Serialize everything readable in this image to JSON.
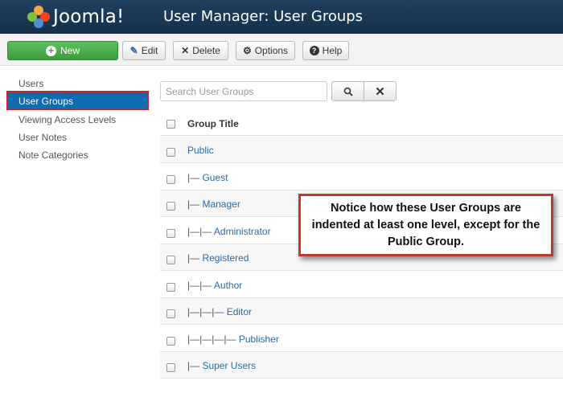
{
  "header": {
    "logo_text": "Joomla!",
    "title": "User Manager: User Groups"
  },
  "toolbar": {
    "new_label": "New",
    "edit_label": "Edit",
    "delete_label": "Delete",
    "options_label": "Options",
    "help_label": "Help"
  },
  "sidebar": {
    "items": [
      "Users",
      "User Groups",
      "Viewing Access Levels",
      "User Notes",
      "Note Categories"
    ],
    "active_index": 1
  },
  "search": {
    "placeholder": "Search User Groups"
  },
  "table": {
    "header": "Group Title",
    "rows": [
      {
        "prefix": "",
        "name": "Public"
      },
      {
        "prefix": "|— ",
        "name": "Guest"
      },
      {
        "prefix": "|— ",
        "name": "Manager"
      },
      {
        "prefix": "|—|— ",
        "name": "Administrator"
      },
      {
        "prefix": "|— ",
        "name": "Registered"
      },
      {
        "prefix": "|—|— ",
        "name": "Author"
      },
      {
        "prefix": "|—|—|— ",
        "name": "Editor"
      },
      {
        "prefix": "|—|—|—|— ",
        "name": "Publisher"
      },
      {
        "prefix": "|— ",
        "name": "Super Users"
      }
    ]
  },
  "callout": {
    "text": "Notice how these User Groups are indented at least one level, except for the Public Group."
  },
  "colors": {
    "header_bg": "#1b3652",
    "new_button": "#4cae4c",
    "active_nav": "#0d6bb0",
    "highlight_border": "#c0282a",
    "link": "#2a6aa8"
  }
}
